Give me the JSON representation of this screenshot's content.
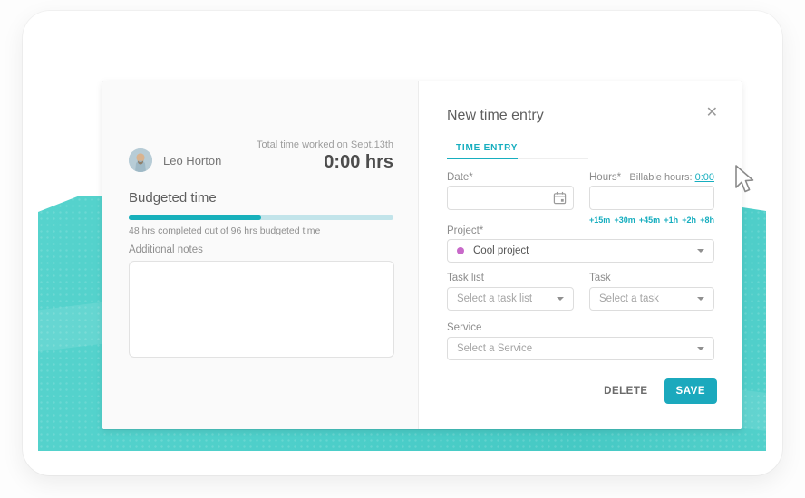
{
  "left_panel": {
    "user_name": "Leo Horton",
    "total_time_label": "Total time worked on Sept.13th",
    "total_time_value": "0:00 hrs",
    "budget_title": "Budgeted time",
    "progress_percent": 50,
    "progress_caption": "48 hrs completed out of 96 hrs budgeted time",
    "notes_label": "Additional notes",
    "notes_value": ""
  },
  "dialog": {
    "title": "New time entry",
    "close_icon": "✕",
    "tab_label": "TIME ENTRY",
    "date_label": "Date*",
    "date_value": "",
    "hours_label": "Hours*",
    "hours_value": "",
    "billable_label": "Billable hours:",
    "billable_value": "0:00",
    "quick_add": [
      "+15m",
      "+30m",
      "+45m",
      "+1h",
      "+2h",
      "+8h"
    ],
    "project_label": "Project*",
    "project_value": "Cool project",
    "task_list_label": "Task list",
    "task_list_placeholder": "Select a task list",
    "task_label": "Task",
    "task_placeholder": "Select a task",
    "service_label": "Service",
    "service_placeholder": "Select a Service",
    "delete_label": "DELETE",
    "save_label": "SAVE"
  },
  "colors": {
    "accent": "#17aebf",
    "wave_teal": "#4ecfca",
    "progress_fill": "#17b0bb",
    "progress_track": "#c2e4ea",
    "project_dot": "#c869c9",
    "save_button": "#1ba9bd"
  }
}
